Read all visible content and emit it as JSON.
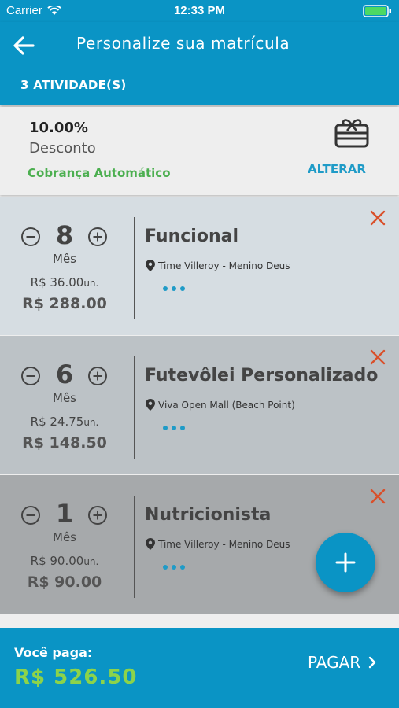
{
  "status_bar": {
    "carrier": "Carrier",
    "time": "12:33 PM"
  },
  "header": {
    "title": "Personalize sua matrícula",
    "activity_count": "3  ATIVIDADE(S)"
  },
  "discount": {
    "percent": "10.00%",
    "label": "Desconto",
    "billing_mode": "Cobrança Automático",
    "change_label": "ALTERAR"
  },
  "activities": [
    {
      "quantity": "8",
      "unit": "Mês",
      "unit_price": "R$ 36.00",
      "unit_suffix": "un.",
      "total": "R$ 288.00",
      "name": "Funcional",
      "location": "Time Villeroy - Menino Deus",
      "background": "#d6dde2"
    },
    {
      "quantity": "6",
      "unit": "Mês",
      "unit_price": "R$ 24.75",
      "unit_suffix": "un.",
      "total": "R$ 148.50",
      "name": "Futevôlei Personalizado",
      "location": "Viva Open Mall (Beach Point)",
      "background": "#bcc2c6"
    },
    {
      "quantity": "1",
      "unit": "Mês",
      "unit_price": "R$ 90.00",
      "unit_suffix": "un.",
      "total": "R$ 90.00",
      "name": "Nutricionista",
      "location": "Time Villeroy - Menino Deus",
      "background": "#a6a9ab"
    }
  ],
  "footer": {
    "you_pay_label": "Você paga:",
    "amount": "R$ 526.50",
    "pay_label": "PAGAR"
  },
  "colors": {
    "primary": "#0a94c5",
    "accent_green": "#8cd34a",
    "remove_red": "#d9502b"
  },
  "icons": {
    "back": "arrow-left-icon",
    "gift": "gift-card-icon",
    "remove": "close-icon",
    "add": "plus-icon",
    "location": "map-pin-icon"
  }
}
